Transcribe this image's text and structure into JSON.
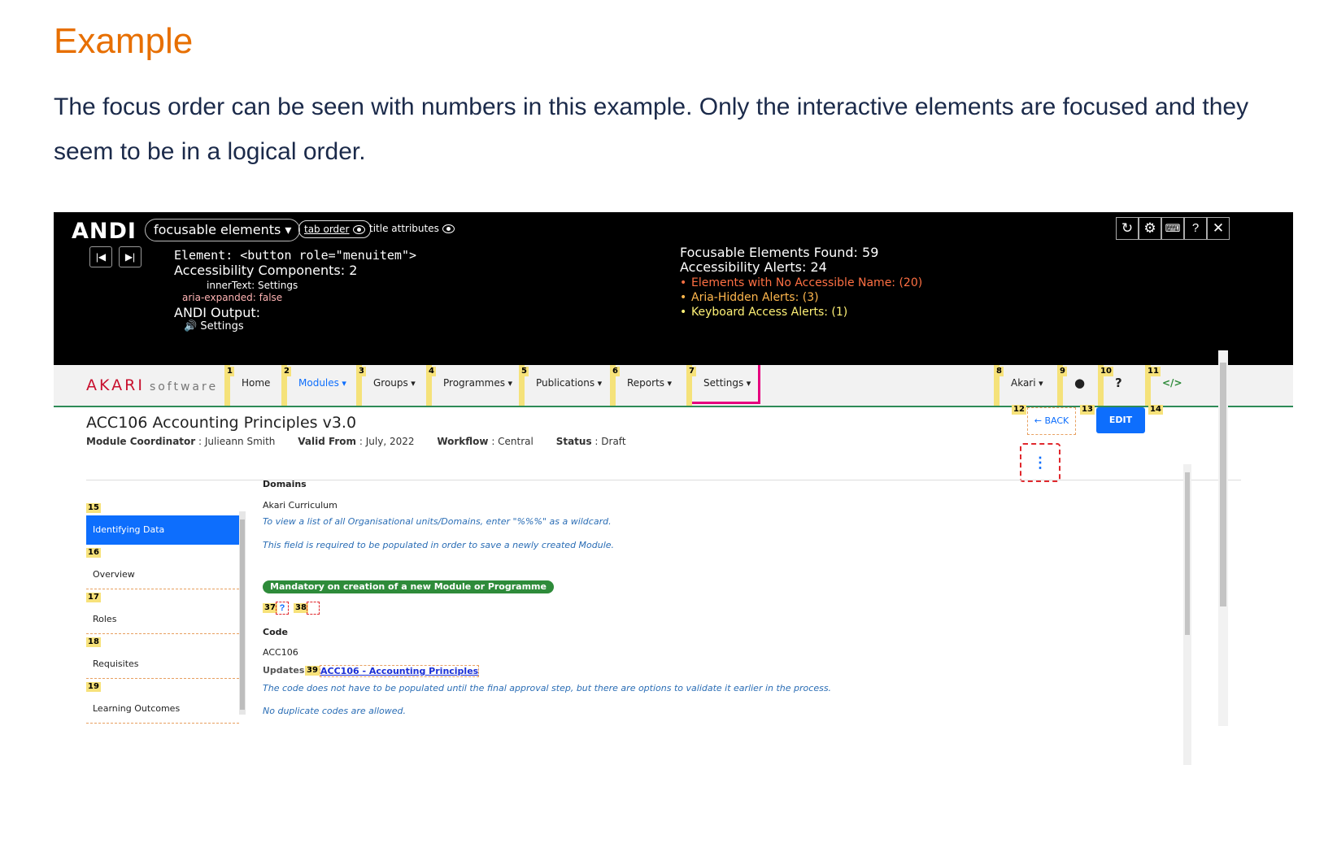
{
  "doc": {
    "title": "Example",
    "paragraph": "The focus order can be seen with numbers in this example. Only the interactive elements are focused and they seem to be in a logical order."
  },
  "andi": {
    "logo": "ANDI",
    "mode": "focusable elements",
    "tab_order": "tab order",
    "title_attributes": "title attributes",
    "prev_icon": "skip-previous-icon",
    "next_icon": "skip-next-icon",
    "element": "Element: <button role=\"menuitem\">",
    "components": "Accessibility Components: 2",
    "inner_text": "innerText: Settings",
    "aria_expanded": "aria-expanded: false",
    "output_label": "ANDI Output:",
    "output_value": "Settings",
    "found": "Focusable Elements Found: 59",
    "alerts": "Accessibility Alerts: 24",
    "alert_items": [
      "Elements with No Accessible Name: (20)",
      "Aria-Hidden Alerts: (3)",
      "Keyboard Access Alerts: (1)"
    ],
    "alert_colors": [
      "#ff7043",
      "#ffb74d",
      "#fff176"
    ],
    "tool_icons": [
      "refresh-icon",
      "gear-icon",
      "keyboard-icon",
      "help-icon",
      "close-icon"
    ],
    "help_glyph": "?"
  },
  "app": {
    "brand": "AKARI",
    "brand_sub": "software",
    "nav": [
      {
        "badge": "1",
        "label": "Home"
      },
      {
        "badge": "2",
        "label": "Modules"
      },
      {
        "badge": "3",
        "label": "Groups"
      },
      {
        "badge": "4",
        "label": "Programmes"
      },
      {
        "badge": "5",
        "label": "Publications"
      },
      {
        "badge": "6",
        "label": "Reports"
      },
      {
        "badge": "7",
        "label": "Settings"
      },
      {
        "badge": "8",
        "label": "Akari"
      },
      {
        "badge": "9",
        "label": ""
      },
      {
        "badge": "10",
        "label": ""
      },
      {
        "badge": "11",
        "label": "</>"
      }
    ],
    "module_title": "ACC106 Accounting Principles v3.0",
    "meta": {
      "coordinator_label": "Module Coordinator",
      "coordinator": "Julieann Smith",
      "valid_from_label": "Valid From",
      "valid_from": "July, 2022",
      "workflow_label": "Workflow",
      "workflow": "Central",
      "status_label": "Status",
      "status": "Draft"
    },
    "back": "← BACK",
    "edit": "EDIT",
    "badges": {
      "back": "12",
      "edit": "13",
      "after_edit": "14",
      "kebab_glyph": "⋮"
    },
    "sidebar": [
      {
        "badge": "15",
        "label": "Identifying Data"
      },
      {
        "badge": "16",
        "label": "Overview"
      },
      {
        "badge": "17",
        "label": "Roles"
      },
      {
        "badge": "18",
        "label": "Requisites"
      },
      {
        "badge": "19",
        "label": "Learning Outcomes"
      }
    ],
    "domains": {
      "label": "Domains",
      "value": "Akari Curriculum",
      "hint1": "To view a list of all Organisational units/Domains, enter \"%%%\" as a wildcard.",
      "hint2": "This field is required to be populated in order to save a newly created Module.",
      "mandatory": "Mandatory on creation of a new Module or Programme",
      "badge37": "37",
      "badge38": "38",
      "help_glyph": "?"
    },
    "code": {
      "label": "Code",
      "value": "ACC106",
      "updates_label": "Updates",
      "badge39": "39",
      "link": "ACC106 - Accounting Principles",
      "hint1": "The code does not have to be populated until the final approval step, but there are options to validate it earlier in the process.",
      "hint2": "No duplicate codes are allowed."
    }
  }
}
